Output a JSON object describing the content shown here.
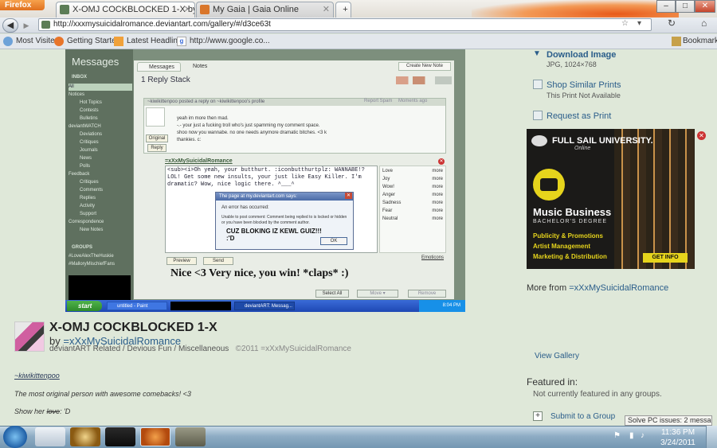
{
  "browser": {
    "app_button": "Firefox",
    "tabs": [
      {
        "label": "X-OMJ COCKBLOCKED 1-X by =xXxM...",
        "active": true
      },
      {
        "label": "My Gaia | Gaia Online",
        "active": false
      }
    ],
    "new_tab": "+",
    "url": "http://xxxmysuicidalromance.deviantart.com/gallery/#/d3ce63t",
    "bookmarks": [
      "Most Visited",
      "Getting Started",
      "Latest Headlines",
      "http://www.google.co..."
    ],
    "bookmarks_menu": "Bookmarks",
    "window_controls": [
      "–",
      "□",
      "✕"
    ]
  },
  "screenshot": {
    "title": "Messages",
    "tabs": [
      "Messages",
      "Notes"
    ],
    "create_note": "Create New Note",
    "stack_title": "1 Reply Stack",
    "inbox_label": "INBOX",
    "nav_items": [
      "All",
      "Notices",
      "Hot Topics",
      "Contests",
      "Bulletins",
      "deviantWATCH",
      "Deviations",
      "Critiques",
      "Journals",
      "News",
      "Polls",
      "Feedback",
      "Critiques",
      "Comments",
      "Replies",
      "Activity",
      "Support",
      "Correspondence",
      "New Notes"
    ],
    "groups_label": "GROUPS",
    "groups": [
      "#LoveAlexTheHuskie",
      "#MalloryMischiefFans"
    ],
    "comment1": {
      "header_prefix": "~kiwikittenpoo posted a reply on",
      "header_suffix": "~kiwikittenpoo's profile",
      "report": "Report Spam",
      "time": "Moments ago",
      "lines": [
        "yeah im more then mad.",
        "-.- your just a fucking troll who's just spamming my comment space.",
        "shoo now you wannabe. no one needs anymore dramatic bitches. <3 k",
        "thankies. c:"
      ],
      "original": "Original",
      "reply": "Reply"
    },
    "comment2": {
      "author": "=xXxMySuicidalRomance",
      "text": "<sub><i>Oh yeah, your butthurt. :iconbutthurtplz: WANNABE!? LOL! Get some new insults, your just like Easy Killer. I'm dramatic? Wow, nice logic there. ^___^",
      "moods": [
        "Love",
        "Joy",
        "Wow!",
        "Anger",
        "Sadness",
        "Fear",
        "Neutral"
      ],
      "more": "more",
      "preview": "Preview",
      "send": "Send",
      "emoticons": "Emoticons"
    },
    "dialog": {
      "title": "The page at my.deviantart.com says:",
      "line1": "An error has occurred:",
      "line2": "Unable to post comment: Comment being replied to is locked or hidden or you have been blocked by the comment author.",
      "overlay": "CUZ BLOKING IZ KEWL GUIZ!!!",
      "face": ":'D",
      "ok": "OK"
    },
    "annotation": "Nice <3  Very nice, you win! *claps* :)",
    "select_all": "Select All",
    "move": "Move ▾",
    "remove": "Remove",
    "xp_start": "start",
    "xp_tasks": [
      "untitled - Paint",
      "deviantART: Messag..."
    ],
    "xp_clock": "8:04 PM"
  },
  "deviation": {
    "title": "X-OMJ COCKBLOCKED 1-X",
    "by": "by",
    "author": "=xXxMySuicidalRomance",
    "categories": "deviantART Related / Devious Fun / Miscellaneous",
    "copyright": "©2011 =xXxMySuicidalRomance",
    "desc_user": "~kiwikittenpoo",
    "desc_line1": "The most original person with awesome comebacks! <3",
    "desc_line2_pre": "Show her",
    "desc_line2_strike": "love",
    "desc_line2_post": ": 'D"
  },
  "sidebar": {
    "download_label": "Download Image",
    "download_sub": "JPG, 1024×768",
    "similar_label": "Shop Similar Prints",
    "similar_sub": "This Print Not Available",
    "request_label": "Request as Print",
    "more_from_prefix": "More from",
    "more_from_user": "=xXxMySuicidalRomance",
    "view_gallery": "View Gallery",
    "featured_title": "Featured in:",
    "featured_text": "Not currently featured in any groups.",
    "submit_group": "Submit to a Group",
    "pc_issues": "Solve PC issues: 2 messages"
  },
  "ad": {
    "brand": "FULL SAIL UNIVERSITY.",
    "brand_sub": "Online",
    "heading": "Music Business",
    "degree": "BACHELOR'S DEGREE",
    "items": [
      "Publicity & Promotions",
      "Artist Management",
      "Marketing & Distribution"
    ],
    "cta": "GET INFO"
  },
  "taskbar": {
    "time": "11:36 PM",
    "date": "3/24/2011"
  }
}
